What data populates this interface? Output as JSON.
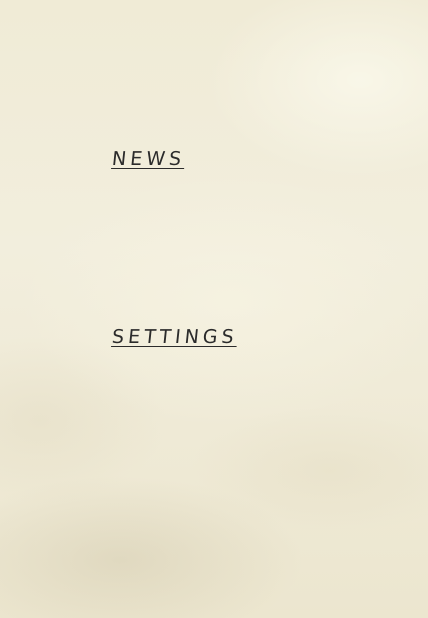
{
  "menu": {
    "items": [
      {
        "label": "NEWS"
      },
      {
        "label": "SETTINGS"
      }
    ]
  }
}
